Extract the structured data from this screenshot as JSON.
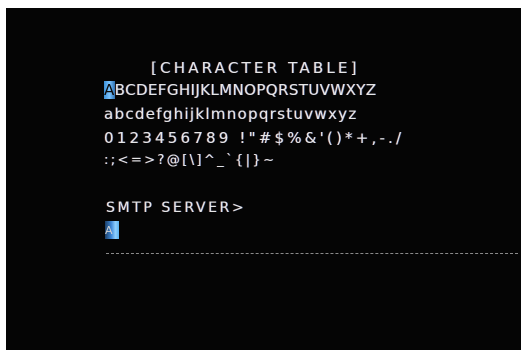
{
  "screen": {
    "title": "[CHARACTER TABLE]",
    "table": {
      "row1_highlighted_char": "A",
      "row1_rest": "BCDEFGHIJKLMNOPQRSTUVWXYZ",
      "row2": "abcdefghijklmnopqrstuvwxyz",
      "row3": "0123456789 !\"#$%&'()*+,-./",
      "row4": ":;<=>?@[\\]^_`{|}~"
    },
    "prompt": "SMTP SERVER>",
    "cursor_char": "A"
  },
  "colors": {
    "background": "#050505",
    "text": "#e6e6e6",
    "selection": "#5ab2f0"
  }
}
